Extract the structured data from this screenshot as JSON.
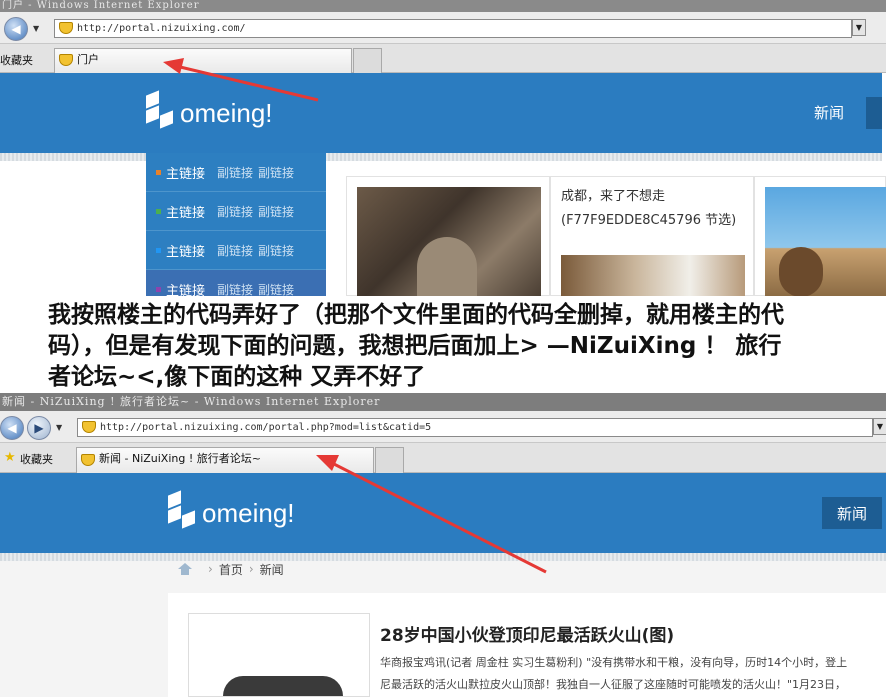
{
  "top": {
    "window_title": "门户 - Windows Internet Explorer",
    "address": "http://portal.nizuixing.com/",
    "favorites_label": "收藏夹",
    "tab_label": "门户",
    "logo_text": "omeing!",
    "nav_item": "新闻",
    "menu": [
      {
        "main": "主链接",
        "subs": [
          "副链接",
          "副链接"
        ],
        "bullet_color": "#e8822a"
      },
      {
        "main": "主链接",
        "subs": [
          "副链接",
          "副链接"
        ],
        "bullet_color": "#4caf50"
      },
      {
        "main": "主链接",
        "subs": [
          "副链接",
          "副链接"
        ],
        "bullet_color": "#2196f3"
      },
      {
        "main": "主链接",
        "subs": [
          "副链接",
          "副链接"
        ],
        "bullet_color": "#8e44ad"
      }
    ],
    "article_title_line1": "成都，来了不想走",
    "article_title_line2": "(F77F9EDDE8C45796 节选)"
  },
  "overlay_text": {
    "line1": "我按照楼主的代码弄好了（把那个文件里面的代码全删掉，就用楼主的代",
    "line2": "码），但是有发现下面的问题，我想把后面加上> —NiZuiXing ！ 旅行",
    "line3": "者论坛~<,像下面的这种 又弄不好了"
  },
  "bottom": {
    "window_title": "新闻 - NiZuiXing ! 旅行者论坛~ - Windows Internet Explorer",
    "address": "http://portal.nizuixing.com/portal.php?mod=list&catid=5",
    "favorites_label": "收藏夹",
    "tab_label": "新闻 - NiZuiXing ! 旅行者论坛~",
    "logo_text": "omeing!",
    "nav_item": "新闻",
    "breadcrumb": [
      "首页",
      "新闻"
    ],
    "headline": "28岁中国小伙登顶印尼最活跃火山(图)",
    "summary_line1": "华商报宝鸡讯(记者 周金柱 实习生葛粉利) \"没有携带水和干粮，没有向导，历时14个小时，登上",
    "summary_line2": "尼最活跃的活火山默拉皮火山顶部！我独自一人征服了这座随时可能喷发的活火山！\"1月23日，"
  },
  "colors": {
    "banner": "#2b7cc0",
    "arrow": "#e53935"
  }
}
